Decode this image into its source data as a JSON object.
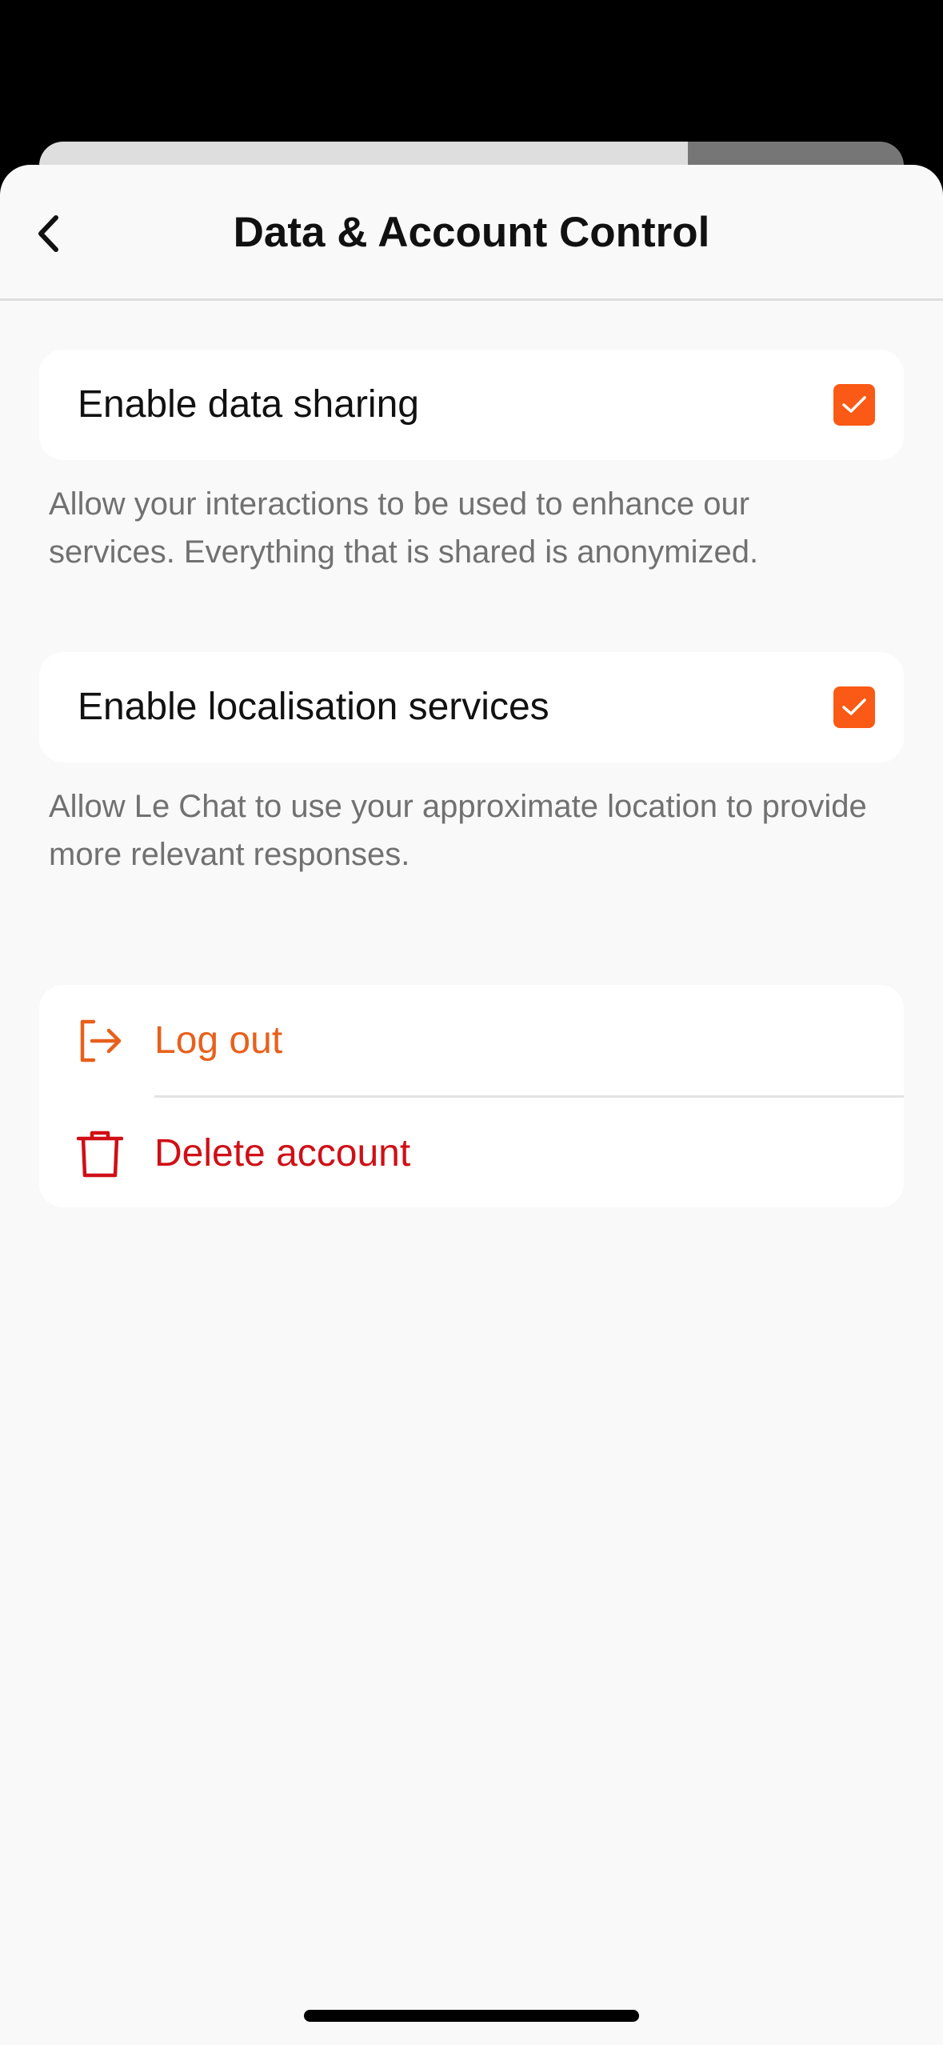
{
  "header": {
    "title": "Data & Account Control"
  },
  "settings": [
    {
      "label": "Enable data sharing",
      "checked": true,
      "description": "Allow your interactions to be used to enhance our services. Everything that is shared is anonymized."
    },
    {
      "label": "Enable localisation services",
      "checked": true,
      "description": "Allow Le Chat to use your approximate location to provide more relevant responses."
    }
  ],
  "account": {
    "logout_label": "Log out",
    "delete_label": "Delete account"
  },
  "icons": {
    "back": "chevron-left-icon",
    "checkbox": "checkmark-icon",
    "logout": "logout-icon",
    "delete": "trash-icon"
  },
  "colors": {
    "accent": "#fa5a15",
    "logout": "#e8601c",
    "danger": "#d00f16",
    "background": "#f9f9f9",
    "card": "#ffffff",
    "description_text": "#717171"
  }
}
